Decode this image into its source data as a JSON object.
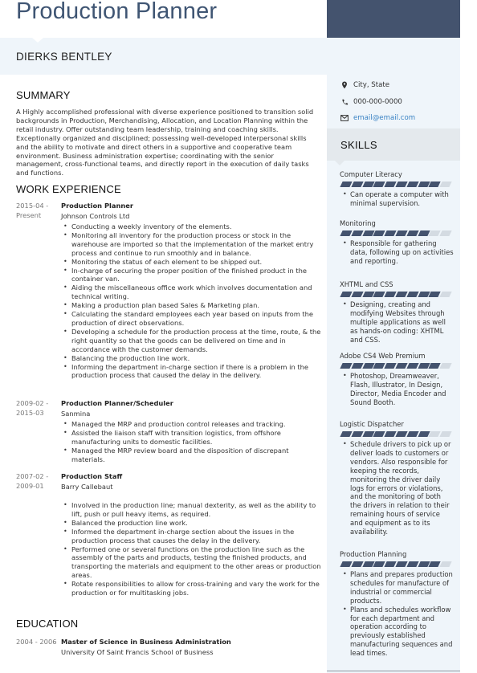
{
  "header": {
    "title": "Production Planner",
    "name": "DIERKS BENTLEY"
  },
  "contact": {
    "location": "City, State",
    "phone": "000-000-0000",
    "email": "email@email.com",
    "location_icon": "map-pin-icon",
    "phone_icon": "phone-icon",
    "email_icon": "envelope-icon"
  },
  "summary": {
    "heading": "SUMMARY",
    "text": "A Highly accomplished professional with diverse experience positioned to transition solid backgrounds in Production, Merchandising, Allocation, and Location Planning within the retail industry. Offer outstanding team leadership, training and coaching skills. Exceptionally organized and disciplined; possessing well-developed interpersonal skills and the ability to motivate and direct others in a supportive and cooperative team environment. Business administration expertise; coordinating with the senior management, cross-functional teams, and directly report in the execution of daily tasks and functions."
  },
  "work": {
    "heading": "WORK EXPERIENCE",
    "jobs": [
      {
        "date_start": "2015-04 -",
        "date_end": "Present",
        "role": "Production Planner",
        "company": "Johnson Controls Ltd",
        "bullets": [
          "Conducting a weekly inventory of the elements.",
          "Monitoring all inventory for the production process or stock in the warehouse are imported so that the implementation of the market entry process and continue to run smoothly and in balance.",
          "Monitoring the status of each element to be shipped out.",
          "In-charge of securing the proper position of the finished product in the container van.",
          "Aiding the miscellaneous office work which involves documentation and technical writing.",
          "Making a production plan based Sales & Marketing plan.",
          "Calculating the standard employees each year based on inputs from the production of direct observations.",
          "Developing a schedule for the production process at the time, route, & the right quantity so that the goods can be delivered on time and in accordance with the customer demands.",
          "Balancing the production line work.",
          "Informing the department in-charge section if there is a problem in the production process that caused the delay in the delivery."
        ]
      },
      {
        "date_start": "2009-02 -",
        "date_end": "2015-03",
        "role": "Production Planner/Scheduler",
        "company": "Sanmina",
        "bullets": [
          "Managed the MRP and production control releases and tracking.",
          "Assisted the liaison staff with transition logistics, from offshore manufacturing units to domestic facilities.",
          "Managed the MRP review board and the disposition of discrepant materials."
        ]
      },
      {
        "date_start": "2007-02 -",
        "date_end": "2009-01",
        "role": "Production Staff",
        "company": "Barry Callebaut",
        "bullets": [
          "Involved in the production line; manual dexterity, as well as the ability to lift, push or pull heavy items, as required.",
          "Balanced the production line work.",
          "Informed the department in-charge section about the issues in the production process that causes the delay in the delivery.",
          "Performed one or several functions on the production line such as the assembly of the parts and products, testing the finished products, and transporting the materials and equipment to the other areas or production areas.",
          "Rotate responsibilities to allow for cross-training and vary the work for the production or for multitasking jobs."
        ]
      }
    ]
  },
  "education": {
    "heading": "EDUCATION",
    "items": [
      {
        "dates": "2004 - 2006",
        "degree": "Master of Science in Business Administration",
        "school": "University Of Saint Francis School of Business"
      }
    ]
  },
  "skills": {
    "heading": "SKILLS",
    "scale_max": 10,
    "accent_color": "#44536e",
    "inactive_color": "#d4dbe2",
    "items": [
      {
        "name": "Computer Literacy",
        "level": 9,
        "bullets": [
          "Can operate a computer with minimal supervision."
        ]
      },
      {
        "name": "Monitoring",
        "level": 8,
        "bullets": [
          "Responsible for gathering data, following up on activities and reporting."
        ]
      },
      {
        "name": "XHTML and CSS",
        "level": 9,
        "bullets": [
          "Designing, creating and modifying Websites through multiple applications as well as hands-on coding: XHTML and CSS."
        ]
      },
      {
        "name": "Adobe CS4 Web Premium",
        "level": 9,
        "bullets": [
          "Photoshop, Dreamweaver, Flash, Illustrator, In Design, Director, Media Encoder and Sound Booth."
        ]
      },
      {
        "name": "Logistic Dispatcher",
        "level": 8,
        "bullets": [
          "Schedule drivers to pick up or deliver loads to customers or vendors. Also responsible for keeping the records, monitoring the driver daily logs for errors or violations, and the monitoring of both the drivers in relation to their remaining hours of service and equipment as to its availability."
        ]
      },
      {
        "name": "Production Planning",
        "level": 9,
        "bullets": [
          "Plans and prepares production schedules for manufacture of industrial or commercial products.",
          "Plans and schedules workflow for each department and operation according to previously established manufacturing sequences and lead times."
        ]
      }
    ]
  }
}
